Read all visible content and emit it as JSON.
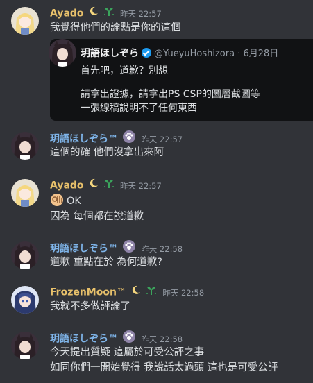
{
  "colors": {
    "background": "#313338",
    "ayado_name": "#e8c16b",
    "hoshizora_name": "#7fb5ea",
    "frozen_name": "#e8c16b",
    "timestamp": "#949ba4",
    "text": "#dbdee1",
    "embed_bg": "#111214"
  },
  "messages": [
    {
      "author": "Ayado",
      "badges": [
        "moon-icon",
        "sprout-icon"
      ],
      "timestamp": "昨天 22:57",
      "lines": [
        "我覺得他們的論點是你的這個"
      ],
      "embed": {
        "author_name": "玥語ほしぞら",
        "handle": "@YueyuHoshizora · 6月28日",
        "lines": [
          "首先吧，道歉？別想",
          "請拿出證據，請拿出PS CSP的圖層截圖等",
          "一張線稿說明不了任何東西"
        ]
      }
    },
    {
      "author": "玥語ほしぞら™",
      "badges": [
        "paw-icon"
      ],
      "timestamp": "昨天 22:57",
      "lines": [
        "這個的確 他們沒拿出來阿"
      ]
    },
    {
      "author": "Ayado",
      "badges": [
        "moon-icon",
        "sprout-icon"
      ],
      "timestamp": "昨天 22:57",
      "lines": [
        "OK",
        "因為 每個都在說道歉"
      ],
      "emoji": "ok-hand-emoji"
    },
    {
      "author": "玥語ほしぞら™",
      "badges": [
        "paw-icon"
      ],
      "timestamp": "昨天 22:58",
      "lines": [
        "道歉 重點在於 為何道歉?"
      ]
    },
    {
      "author": "FrozenMoon™",
      "badges": [
        "moon-icon",
        "sprout-icon"
      ],
      "timestamp": "昨天 22:58",
      "lines": [
        "我就不多做評論了"
      ]
    },
    {
      "author": "玥語ほしぞら™",
      "badges": [
        "paw-icon"
      ],
      "timestamp": "昨天 22:58",
      "lines": [
        "今天提出質疑 這屬於可受公評之事",
        "如同你們一開始覺得 我說話太過頭 這也是可受公評"
      ]
    }
  ]
}
